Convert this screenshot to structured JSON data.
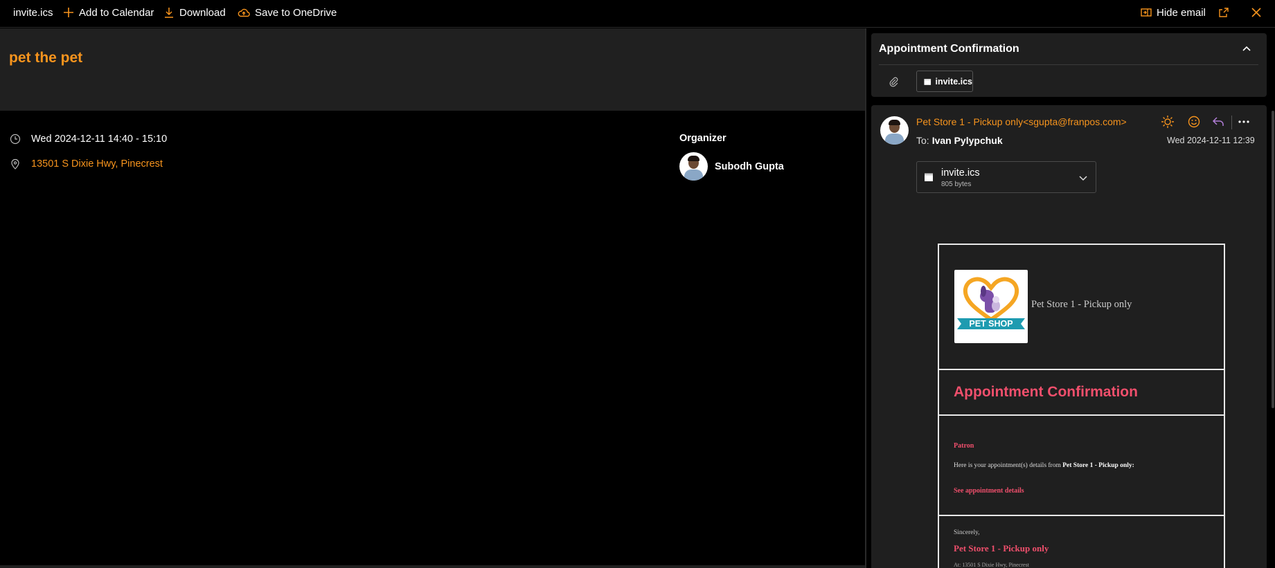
{
  "toolbar": {
    "file_name": "invite.ics",
    "add_to_calendar": "Add to Calendar",
    "download": "Download",
    "save_to_onedrive": "Save to OneDrive",
    "hide_email": "Hide email"
  },
  "event": {
    "title": "pet the pet",
    "datetime": "Wed 2024-12-11 14:40 - 15:10",
    "location": "13501 S Dixie Hwy, Pinecrest",
    "organizer_label": "Organizer",
    "organizer_name": "Subodh Gupta"
  },
  "message": {
    "subject": "Appointment Confirmation",
    "attachment_chip": "invite.ics",
    "sender": "Pet Store 1 - Pickup only<sgupta@franpos.com>",
    "to_label": "To:",
    "to_name": "Ivan Pylypchuk",
    "date": "Wed 2024-12-11 12:39",
    "attachment": {
      "name": "invite.ics",
      "size": "805 bytes"
    }
  },
  "email_body": {
    "store_name": "Pet Store 1 - Pickup only",
    "logo_text": "PET SHOP",
    "heading": "Appointment Confirmation",
    "patron": "Patron",
    "details_prefix": "Here is your appointment(s) details from ",
    "details_store": "Pet Store 1 - Pickup only:",
    "see_details": "See appointment details",
    "sincerely": "Sincerely,",
    "signature": "Pet Store 1 - Pickup only",
    "address_cut": "At: 13501 S Dixie Hwy, Pinecrest"
  },
  "colors": {
    "accent_orange": "#f7941d",
    "email_pink": "#f04f6c",
    "pane_gray": "#1f1f1f",
    "arrow_red": "#e81818"
  }
}
